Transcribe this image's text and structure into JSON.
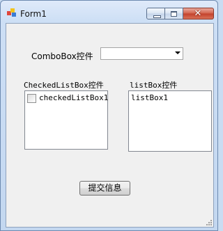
{
  "window": {
    "title": "Form1",
    "close_glyph": "✕"
  },
  "form": {
    "combobox_label": "ComboBox控件",
    "combobox_value": "",
    "checkedlistbox_label": "CheckedListBox控件",
    "checkedlistbox_items": [
      {
        "text": "checkedListBox1",
        "checked": false
      }
    ],
    "listbox_label": "listBox控件",
    "listbox_items": [
      "listBox1"
    ],
    "submit_label": "提交信息"
  },
  "colors": {
    "title_bar": "#cddff5",
    "client_bg": "#f0f0f0",
    "close_button": "#c2402a"
  }
}
